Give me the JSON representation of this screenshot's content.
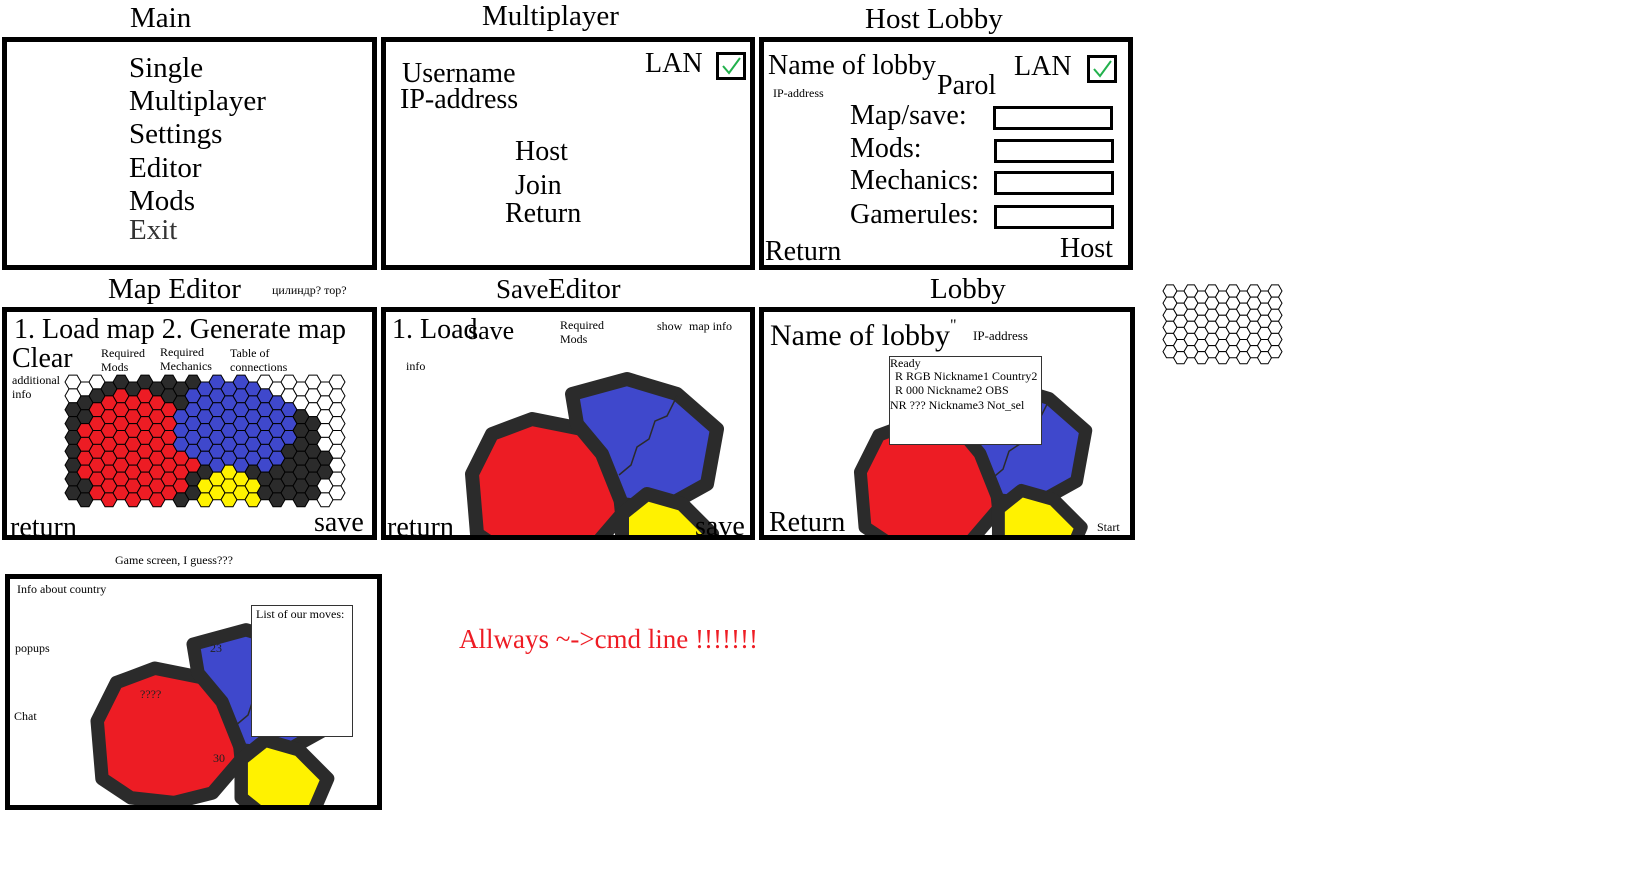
{
  "titles": {
    "main": "Main",
    "multiplayer": "Multiplayer",
    "host_lobby": "Host Lobby",
    "map_editor": "Map Editor",
    "map_editor_note": "цилиндр? тор?",
    "save_editor_a": "Save",
    "save_editor_b": "Editor",
    "lobby": "Lobby",
    "game_screen": "Game screen, I guess???"
  },
  "main_menu": {
    "items": [
      "Single",
      "Multiplayer",
      "Settings",
      "Editor",
      "Mods",
      "Exit"
    ]
  },
  "multiplayer": {
    "username": "Username",
    "ip": "IP-address",
    "lan": "LAN",
    "lan_checked": true,
    "host": "Host",
    "join": "Join",
    "return": "Return"
  },
  "host_lobby": {
    "name": "Name of lobby",
    "lan": "LAN",
    "ip": "IP-address",
    "parol": "Parol",
    "map_save": "Map/save:",
    "mods": "Mods:",
    "mechanics": "Mechanics:",
    "gamerules": "Gamerules:",
    "return": "Return",
    "host": "Host"
  },
  "map_editor": {
    "load_generate": "1. Load map 2. Generate map",
    "clear": "Clear",
    "required_mods_1": "Required",
    "required_mods_2": "Mods",
    "required_mech_1": "Required",
    "required_mech_2": "Mechanics",
    "table_conn_1": "Table of",
    "table_conn_2": "connections",
    "additional_1": "additional",
    "additional_2": "info",
    "return": "return",
    "save": "save"
  },
  "save_editor": {
    "load_a": "1. Load",
    "load_b": "save",
    "required_1": "Required",
    "required_2": "Mods",
    "show_a": "show",
    "show_b": "map info",
    "info": "info",
    "return": "return",
    "save": "save"
  },
  "lobby": {
    "name": "Name of lobby",
    "quote": "\"",
    "ip": "IP-address",
    "ready": "Ready",
    "players": [
      "R  RGB Nickname1 Country2",
      "R  000    Nickname2 OBS",
      "NR ???  Nickname3 Not_sel"
    ],
    "return": "Return",
    "start": "Start"
  },
  "game": {
    "info_country": "Info about country",
    "popups": "popups",
    "chat": "Chat",
    "moves_title": "List of our moves:",
    "num_blue": "23",
    "num_red": "????",
    "num_yellow": "30"
  },
  "note": "Allways ~->cmd line !!!!!!!",
  "colors": {
    "red": "#ed1c24",
    "blue": "#3f48cc",
    "yellow": "#fff200",
    "dark": "#2b2b2b",
    "check": "#22b14c",
    "note": "#ee1c24"
  }
}
